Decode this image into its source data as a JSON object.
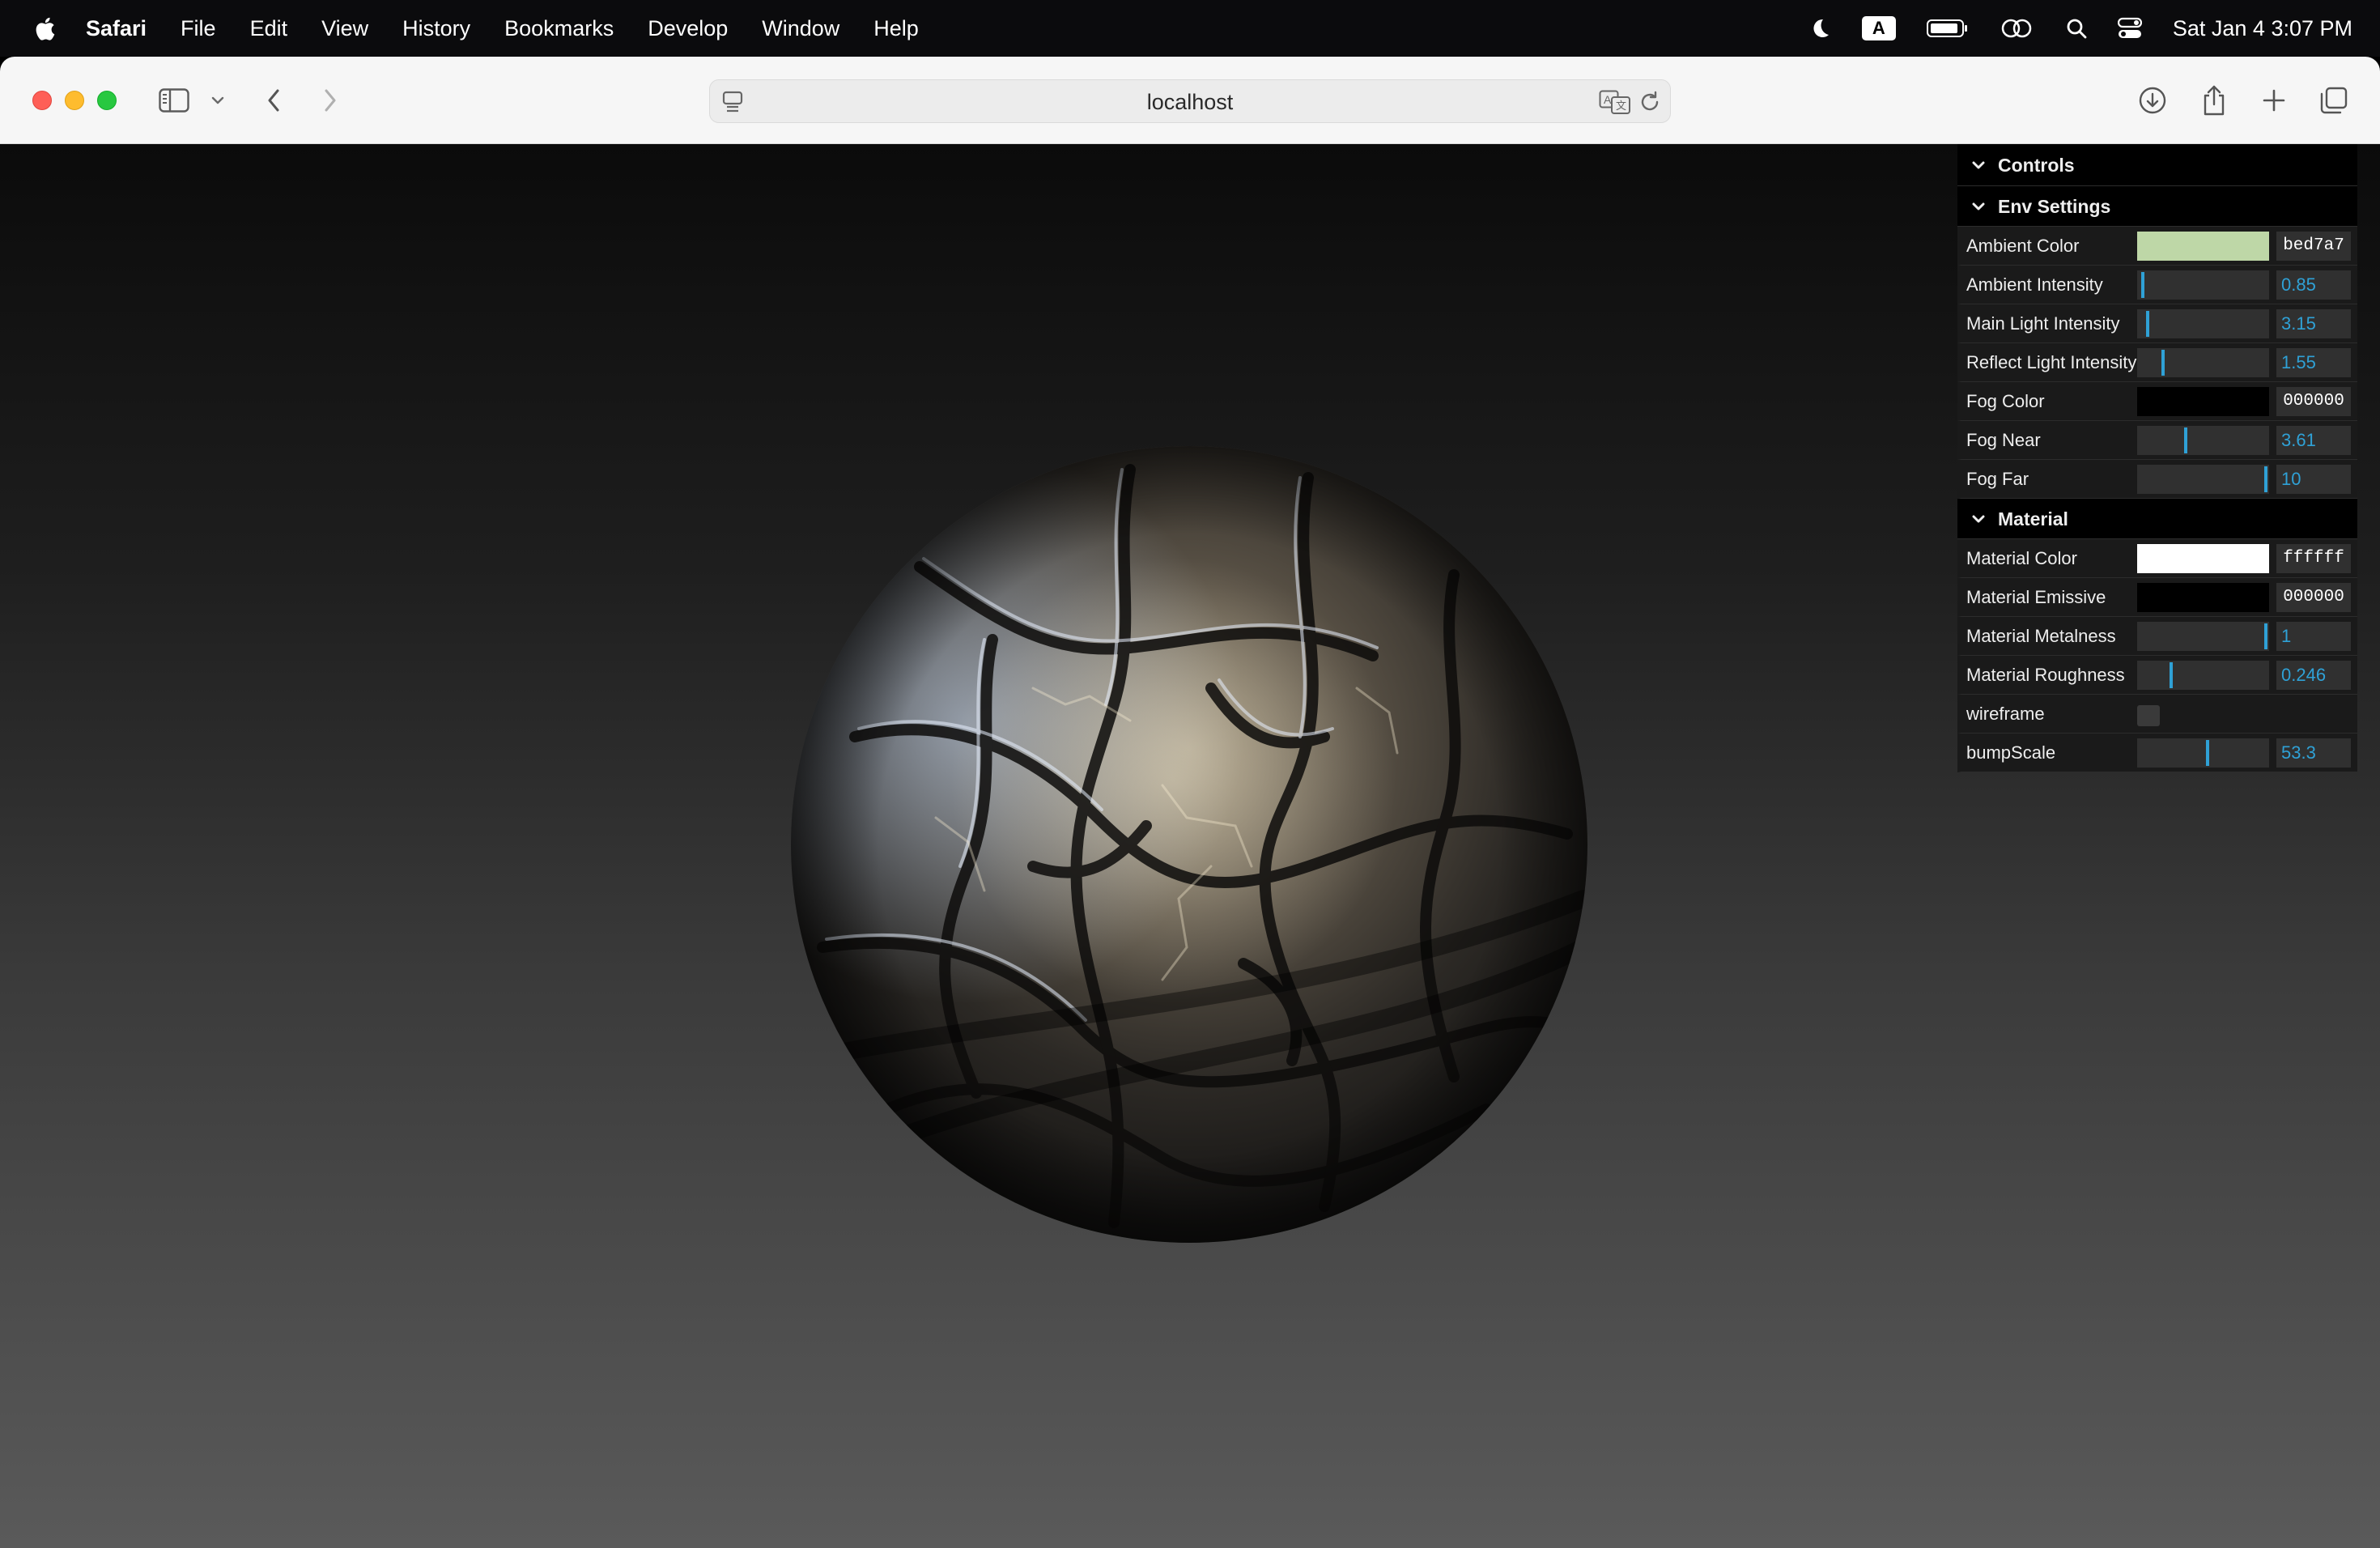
{
  "menubar": {
    "app_name": "Safari",
    "menus": [
      "File",
      "Edit",
      "View",
      "History",
      "Bookmarks",
      "Develop",
      "Window",
      "Help"
    ],
    "input_badge": "A",
    "clock": "Sat Jan 4  3:07 PM"
  },
  "browser": {
    "url": "localhost"
  },
  "gui": {
    "root_title": "Controls",
    "env": {
      "title": "Env Settings",
      "ambient_color": {
        "label": "Ambient Color",
        "hex": "bed7a7",
        "color": "#bed7a7"
      },
      "ambient_intensity": {
        "label": "Ambient Intensity",
        "value": "0.85",
        "fraction": 0.02
      },
      "main_light_intensity": {
        "label": "Main Light Intensity",
        "value": "3.15",
        "fraction": 0.06
      },
      "reflect_light_intensity": {
        "label": "Reflect Light Intensity",
        "value": "1.55",
        "fraction": 0.18
      },
      "fog_color": {
        "label": "Fog Color",
        "hex": "000000",
        "color": "#000000"
      },
      "fog_near": {
        "label": "Fog Near",
        "value": "3.61",
        "fraction": 0.36
      },
      "fog_far": {
        "label": "Fog Far",
        "value": "10",
        "fraction": 1.0
      }
    },
    "material": {
      "title": "Material",
      "material_color": {
        "label": "Material Color",
        "hex": "ffffff",
        "color": "#ffffff"
      },
      "material_emissive": {
        "label": "Material Emissive",
        "hex": "000000",
        "color": "#000000"
      },
      "material_metalness": {
        "label": "Material Metalness",
        "value": "1",
        "fraction": 1.0
      },
      "material_roughness": {
        "label": "Material Roughness",
        "value": "0.246",
        "fraction": 0.246
      },
      "wireframe": {
        "label": "wireframe",
        "checked": false
      },
      "bump_scale": {
        "label": "bumpScale",
        "value": "53.3",
        "fraction": 0.533
      }
    }
  }
}
